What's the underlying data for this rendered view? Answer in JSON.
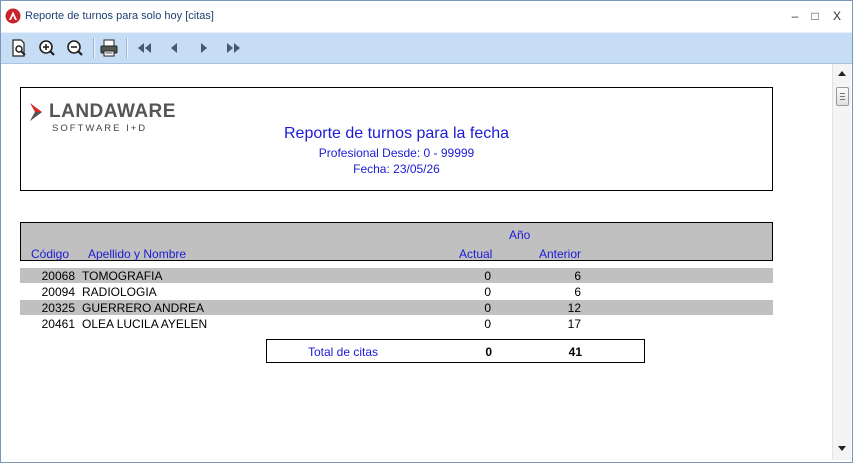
{
  "window": {
    "title": "Reporte de turnos para solo hoy [citas]",
    "minimize_glyph": "–",
    "maximize_glyph": "□",
    "close_glyph": "X"
  },
  "toolbar": {
    "buttons": [
      "preview-icon",
      "zoom-in-icon",
      "zoom-out-icon",
      "print-icon",
      "first-page-icon",
      "previous-page-icon",
      "next-page-icon",
      "last-page-icon"
    ]
  },
  "report": {
    "logo_main": "LANDAWARE",
    "logo_sub": "SOFTWARE I+D",
    "title": "Reporte de turnos para la fecha",
    "subtitle": "Profesional Desde: 0 - 99999",
    "date": "Fecha: 23/05/26",
    "columns": {
      "group": "Año",
      "codigo": "Código",
      "nombre": "Apellido y Nombre",
      "actual": "Actual",
      "anterior": "Anterior"
    },
    "rows": [
      {
        "codigo": "20068",
        "nombre": "TOMOGRAFIA",
        "actual": "0",
        "anterior": "6"
      },
      {
        "codigo": "20094",
        "nombre": "RADIOLOGIA",
        "actual": "0",
        "anterior": "6"
      },
      {
        "codigo": "20325",
        "nombre": "GUERRERO ANDREA",
        "actual": "0",
        "anterior": "12"
      },
      {
        "codigo": "20461",
        "nombre": "OLEA LUCILA AYELEN",
        "actual": "0",
        "anterior": "17"
      }
    ],
    "total": {
      "label": "Total de citas",
      "actual": "0",
      "anterior": "41"
    }
  },
  "colors": {
    "accent_blue": "#1b1bd4",
    "toolbar_bg": "#c7dcf5",
    "row_shade": "#c0c0c0",
    "logo_red": "#d42a2a"
  }
}
